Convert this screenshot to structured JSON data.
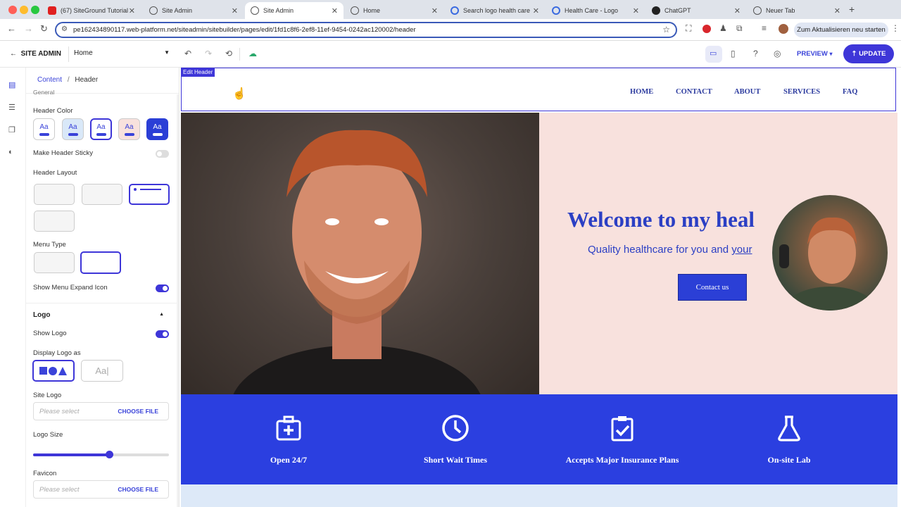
{
  "browser": {
    "tabs": [
      {
        "title": "(67) SiteGround Tutorial",
        "favicon_color": "#e02020"
      },
      {
        "title": "Site Admin",
        "favicon_color": "#555555"
      },
      {
        "title": "Site Admin",
        "favicon_color": "#555555"
      },
      {
        "title": "Home",
        "favicon_color": "#555555"
      },
      {
        "title": "Search logo health care",
        "favicon_color": "#3a6ae0"
      },
      {
        "title": "Health Care - Logo",
        "favicon_color": "#3a6ae0"
      },
      {
        "title": "ChatGPT",
        "favicon_color": "#222222"
      },
      {
        "title": "Neuer Tab",
        "favicon_color": "#555555"
      }
    ],
    "url": "pe162434890117.web-platform.net/siteadmin/sitebuilder/pages/edit/1fd1c8f6-2ef8-11ef-9454-0242ac120002/header",
    "update_chip": "Zum Aktualisieren neu starten"
  },
  "admin": {
    "brand": "SITE ADMIN",
    "page_select": "Home",
    "preview": "PREVIEW",
    "update": "UPDATE"
  },
  "panel": {
    "crumb_root": "Content",
    "crumb_sep": "/",
    "crumb_current": "Header",
    "section_general": "General",
    "header_color_label": "Header Color",
    "swatch_text": "Aa",
    "sticky_label": "Make Header Sticky",
    "layout_label": "Header Layout",
    "menu_type_label": "Menu Type",
    "expand_icon_label": "Show Menu Expand Icon",
    "logo_section": "Logo",
    "show_logo_label": "Show Logo",
    "display_logo_label": "Display Logo as",
    "text_logo_option": "Aa|",
    "site_logo_label": "Site Logo",
    "site_logo_placeholder": "Please select",
    "choose_file": "CHOOSE FILE",
    "logo_size_label": "Logo Size",
    "logo_size_value": 0.56,
    "favicon_label": "Favicon",
    "favicon_placeholder": "Please select"
  },
  "canvas": {
    "edit_tag": "Edit Header",
    "menu": [
      "HOME",
      "CONTACT",
      "ABOUT",
      "SERVICES",
      "FAQ"
    ],
    "hero_title": "Welcome to my heal",
    "hero_sub_main": "Quality healthcare for you and ",
    "hero_sub_link": "your",
    "contact_button": "Contact us",
    "features": [
      "Open 24/7",
      "Short Wait Times",
      "Accepts Major Insurance Plans",
      "On-site Lab"
    ]
  },
  "colors": {
    "accent": "#3e36d8",
    "hero_bg": "#f8e1dd",
    "feature_bg": "#2b3fe0"
  }
}
